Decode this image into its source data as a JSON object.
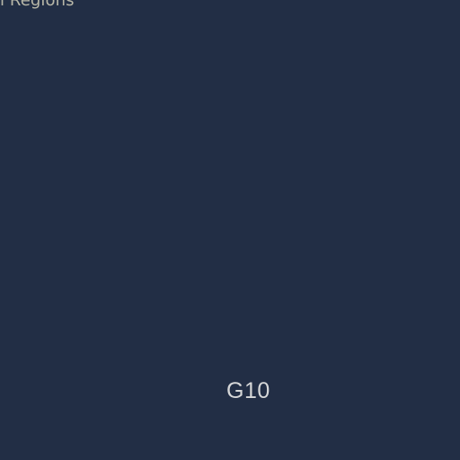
{
  "header": {
    "partial_title": "l Regions"
  },
  "main": {
    "label": "G10"
  }
}
